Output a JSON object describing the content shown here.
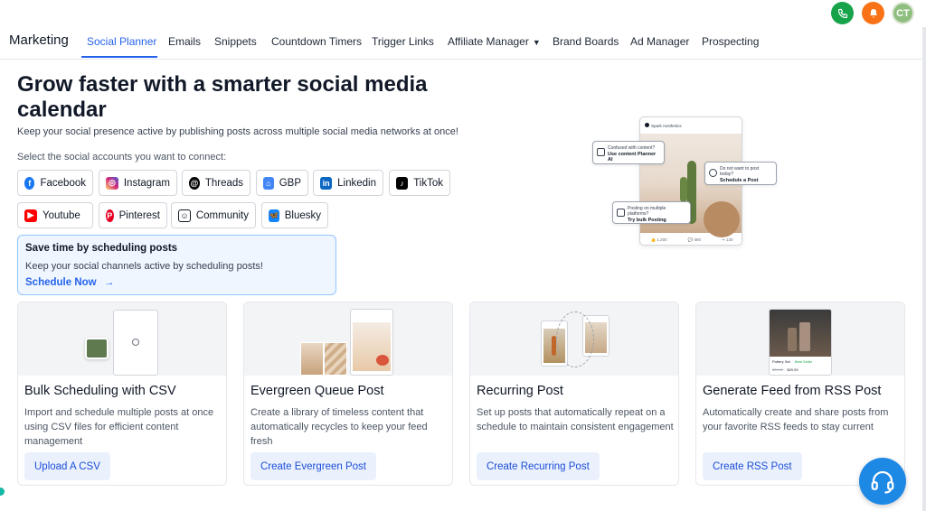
{
  "topbar": {
    "avatar_initials": "CT",
    "phone_color": "#16a34a",
    "bell_color": "#f97316"
  },
  "nav": {
    "brand": "Marketing",
    "tabs": [
      {
        "label": "Social Planner",
        "active": true
      },
      {
        "label": "Emails"
      },
      {
        "label": "Snippets"
      },
      {
        "label": "Countdown Timers"
      },
      {
        "label": "Trigger Links"
      },
      {
        "label": "Affiliate Manager"
      },
      {
        "label": "Brand Boards"
      },
      {
        "label": "Ad Manager"
      },
      {
        "label": "Prospecting"
      }
    ]
  },
  "hero": {
    "title": "Grow faster with a smarter social media calendar",
    "subtitle": "Keep your social presence active by publishing posts across multiple social media networks at once!",
    "select_label": "Select the social accounts you want to connect:"
  },
  "accounts": [
    {
      "label": "Facebook",
      "icon": "facebook-icon",
      "color": "#1877f2"
    },
    {
      "label": "Instagram",
      "icon": "instagram-icon",
      "color": "#d62976"
    },
    {
      "label": "Threads",
      "icon": "threads-icon",
      "color": "#000000"
    },
    {
      "label": "GBP",
      "icon": "gbp-icon",
      "color": "#4285f4"
    },
    {
      "label": "Linkedin",
      "icon": "linkedin-icon",
      "color": "#0a66c2"
    },
    {
      "label": "TikTok",
      "icon": "tiktok-icon",
      "color": "#000000"
    },
    {
      "label": "Youtube",
      "icon": "youtube-icon",
      "color": "#ff0000"
    },
    {
      "label": "Pinterest",
      "icon": "pinterest-icon",
      "color": "#e60023"
    },
    {
      "label": "Community",
      "icon": "community-icon",
      "color": "#111827"
    },
    {
      "label": "Bluesky",
      "icon": "bluesky-icon",
      "color": "#1185fe"
    }
  ],
  "promo": {
    "title": "Save time by scheduling posts",
    "subtitle": "Keep your social channels active by scheduling posts!",
    "link": "Schedule Now"
  },
  "illustration": {
    "account": "Spark Aesthetics",
    "callout_1_q": "Confused with content?",
    "callout_1_a": "Use content Planner AI",
    "callout_2_q": "Do not want to post today?",
    "callout_2_a": "Schedule a Post",
    "callout_3_q": "Posting on multiple platforms?",
    "callout_3_a": "Try bulk Posting",
    "likes": "1,200",
    "comments": "580",
    "shares": "130"
  },
  "cards": [
    {
      "title": "Bulk Scheduling with CSV",
      "desc": "Import and schedule multiple posts at once using CSV files for efficient content management",
      "button": "Upload A CSV"
    },
    {
      "title": "Evergreen Queue Post",
      "desc": "Create a library of timeless content that automatically recycles to keep your feed fresh",
      "button": "Create Evergreen Post"
    },
    {
      "title": "Recurring Post",
      "desc": "Set up posts that automatically repeat on a schedule to maintain consistent engagement",
      "button": "Create Recurring Post"
    },
    {
      "title": "Generate Feed from RSS Post",
      "desc": "Automatically create and share posts from your favorite RSS feeds to stay current",
      "button": "Create RSS Post"
    }
  ],
  "rss_thumb": {
    "product": "Pottery Set",
    "badge": "Best Seller",
    "old_price": "$39.99",
    "price": "$29.99"
  }
}
